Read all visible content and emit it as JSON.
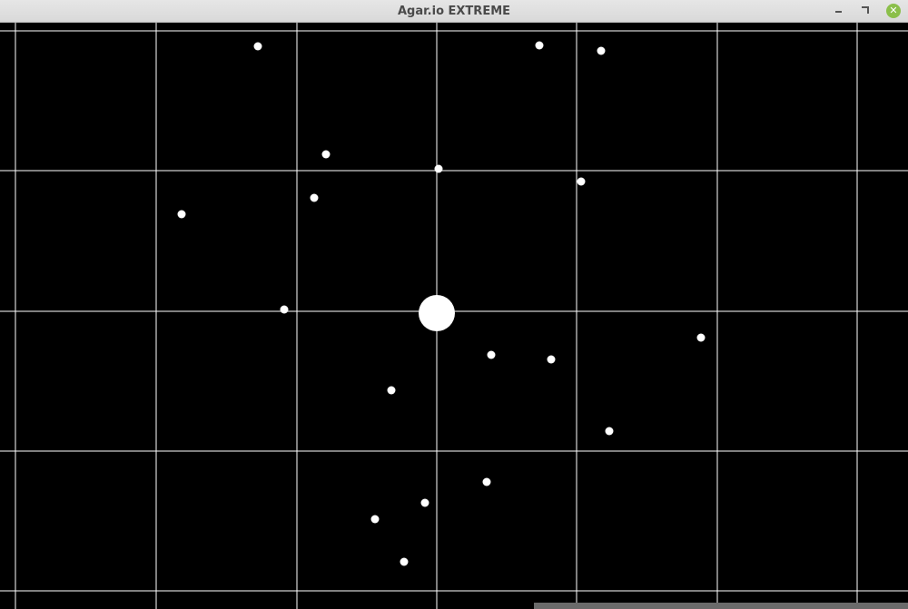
{
  "window": {
    "title": "Agar.io EXTREME",
    "close_glyph": "✕",
    "icons": [
      "minimize-icon",
      "maximize-icon",
      "close-icon"
    ]
  },
  "game": {
    "background_color": "#000000",
    "grid_color": "#ffffff",
    "food_color": "#ffffff",
    "player_color": "#ffffff",
    "accent_close_color": "#8bbf4a"
  }
}
